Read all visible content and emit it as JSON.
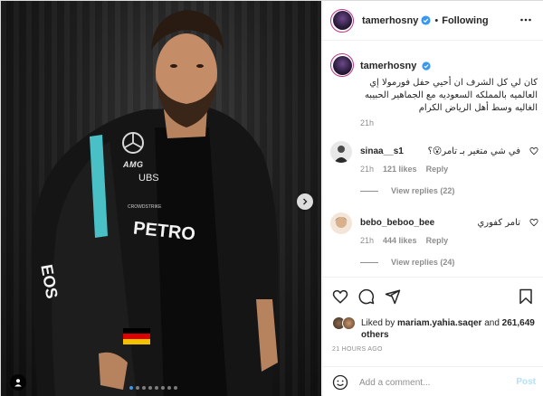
{
  "post": {
    "username": "tamerhosny",
    "follow_separator": "•",
    "follow_status": "Following",
    "caption": "كان لي كل الشرف ان أحيي حفل فورمولا إي العالميه بالمملكه السعوديه مع الجماهير الحبيبه الغاليه وسط أهل الرياض الكرام",
    "caption_time": "21h"
  },
  "photo": {
    "jacket_text_1": "AMG",
    "jacket_text_2": "UBS",
    "jacket_text_3": "PETRO",
    "jacket_text_4": "EOS",
    "jacket_text_5": "CROWDSTRIKE",
    "carousel_count": 8,
    "carousel_active": 0
  },
  "comments": [
    {
      "username": "sinaa__s1",
      "text": "في شي متغير بـ تامر😮؟",
      "time": "21h",
      "likes": "121 likes",
      "reply": "Reply",
      "view_replies": "View replies (22)"
    },
    {
      "username": "bebo_beboo_bee",
      "text": "تامر كفوري",
      "time": "21h",
      "likes": "444 likes",
      "reply": "Reply",
      "view_replies": "View replies (24)"
    }
  ],
  "likes": {
    "prefix": "Liked by",
    "user": "mariam.yahia.saqer",
    "conj": "and",
    "others": "261,649 others"
  },
  "timestamp": "21 HOURS AGO",
  "add_comment": {
    "placeholder": "Add a comment...",
    "post_label": "Post"
  },
  "colors": {
    "accent_blue": "#0095f6",
    "post_disabled": "#b2dffc",
    "muted": "#8e8e8e",
    "text": "#262626"
  },
  "icons": [
    "verified-icon",
    "more-icon",
    "heart-icon",
    "comment-icon",
    "share-icon",
    "bookmark-icon",
    "emoji-icon",
    "chevron-right-icon",
    "user-tag-icon"
  ]
}
